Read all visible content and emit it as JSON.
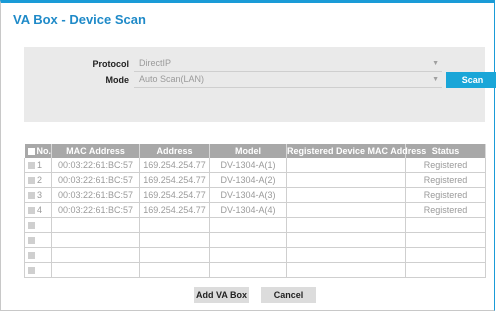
{
  "dialog": {
    "title": "VA Box - Device Scan"
  },
  "settings": {
    "protocol_label": "Protocol",
    "protocol_value": "DirectIP",
    "mode_label": "Mode",
    "mode_value": "Auto Scan(LAN)",
    "scan_label": "Scan"
  },
  "table": {
    "headers": [
      "No.",
      "MAC Address",
      "Address",
      "Model",
      "Registered Device MAC Address",
      "Status"
    ],
    "rows": [
      [
        "1",
        "00:03:22:61:BC:57",
        "169.254.254.77",
        "DV-1304-A(1)",
        "",
        "Registered"
      ],
      [
        "2",
        "00:03:22:61:BC:57",
        "169.254.254.77",
        "DV-1304-A(2)",
        "",
        "Registered"
      ],
      [
        "3",
        "00:03:22:61:BC:57",
        "169.254.254.77",
        "DV-1304-A(3)",
        "",
        "Registered"
      ],
      [
        "4",
        "00:03:22:61:BC:57",
        "169.254.254.77",
        "DV-1304-A(4)",
        "",
        "Registered"
      ],
      [
        "",
        "",
        "",
        "",
        "",
        ""
      ],
      [
        "",
        "",
        "",
        "",
        "",
        ""
      ],
      [
        "",
        "",
        "",
        "",
        "",
        ""
      ],
      [
        "",
        "",
        "",
        "",
        "",
        ""
      ]
    ]
  },
  "footer": {
    "add_label": "Add VA Box",
    "cancel_label": "Cancel"
  }
}
